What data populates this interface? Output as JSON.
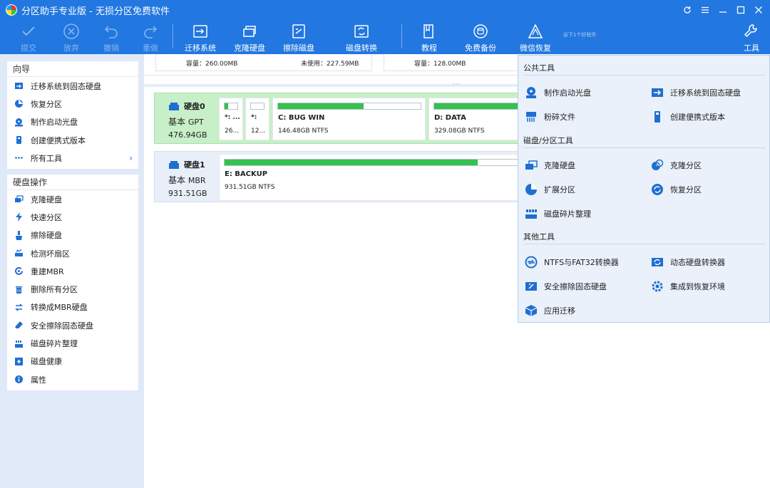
{
  "window": {
    "title": "分区助手专业版 - 无损分区免费软件",
    "controls": [
      "refresh-icon",
      "menu-icon",
      "minimize-icon",
      "maximize-icon",
      "close-icon"
    ]
  },
  "toolbar": {
    "commit": "提交",
    "discard": "放弃",
    "undo": "撤销",
    "redo": "重做",
    "migrate": "迁移系统",
    "clone": "克隆硬盘",
    "wipe": "擦除磁盘",
    "convert": "磁盘转换",
    "tutorial": "教程",
    "backup": "免费备份",
    "recover": "微信恢复",
    "tools": "工具",
    "note": "@下1个好软件"
  },
  "wizard": {
    "header": "向导",
    "items": [
      {
        "label": "迁移系统到固态硬盘",
        "icon": "migrate-icon"
      },
      {
        "label": "恢复分区",
        "icon": "recover-partition-icon"
      },
      {
        "label": "制作启动光盘",
        "icon": "boot-disc-icon"
      },
      {
        "label": "创建便携式版本",
        "icon": "portable-icon"
      },
      {
        "label": "所有工具",
        "icon": "more-icon"
      }
    ]
  },
  "disk_ops": {
    "header": "硬盘操作",
    "items": [
      {
        "label": "克隆硬盘",
        "icon": "clone-disk-icon"
      },
      {
        "label": "快速分区",
        "icon": "lightning-icon"
      },
      {
        "label": "擦除硬盘",
        "icon": "wipe-icon"
      },
      {
        "label": "检测坏扇区",
        "icon": "scan-icon"
      },
      {
        "label": "重建MBR",
        "icon": "rebuild-icon"
      },
      {
        "label": "删除所有分区",
        "icon": "trash-icon"
      },
      {
        "label": "转换成MBR硬盘",
        "icon": "convert-icon"
      },
      {
        "label": "安全擦除固态硬盘",
        "icon": "eraser-icon"
      },
      {
        "label": "磁盘碎片整理",
        "icon": "defrag-icon"
      },
      {
        "label": "磁盘健康",
        "icon": "health-icon"
      },
      {
        "label": "属性",
        "icon": "info-icon"
      }
    ]
  },
  "top_strip": {
    "capacity1": "容量：260.00MB",
    "unused1": "未使用：227.59MB",
    "capacity2": "容量：128.00MB"
  },
  "disks": [
    {
      "name": "硬盘0",
      "type": "基本",
      "style": "GPT",
      "size": "476.94GB",
      "partitions": [
        {
          "label": "*: ...",
          "info": "26...",
          "used": 0.3
        },
        {
          "label": "*:",
          "info": "12...",
          "used": 0.0
        },
        {
          "label": "C: BUG WIN",
          "info": "146.48GB NTFS",
          "used": 0.6
        },
        {
          "label": "D: DATA",
          "info": "329.08GB NTFS",
          "used": 0.75
        }
      ]
    },
    {
      "name": "硬盘1",
      "type": "基本",
      "style": "MBR",
      "size": "931.51GB",
      "partitions": [
        {
          "label": "E: BACKUP",
          "info": "931.51GB NTFS",
          "used": 0.85
        }
      ]
    }
  ],
  "tools_menu": {
    "public_header": "公共工具",
    "public": [
      "制作启动光盘",
      "迁移系统到固态硬盘",
      "粉碎文件",
      "创建便携式版本"
    ],
    "disk_header": "磁盘/分区工具",
    "disk": [
      "克隆硬盘",
      "克隆分区",
      "扩展分区",
      "恢复分区",
      "磁盘碎片整理"
    ],
    "other_header": "其他工具",
    "other": [
      "NTFS与FAT32转换器",
      "动态硬盘转换器",
      "安全擦除固态硬盘",
      "集成到恢复环境",
      "应用迁移"
    ]
  },
  "colors": {
    "accent": "#2277e0",
    "used_bar": "#33c24d",
    "selected_disk": "#c8f0c8",
    "icon_blue": "#1f6fd1"
  }
}
